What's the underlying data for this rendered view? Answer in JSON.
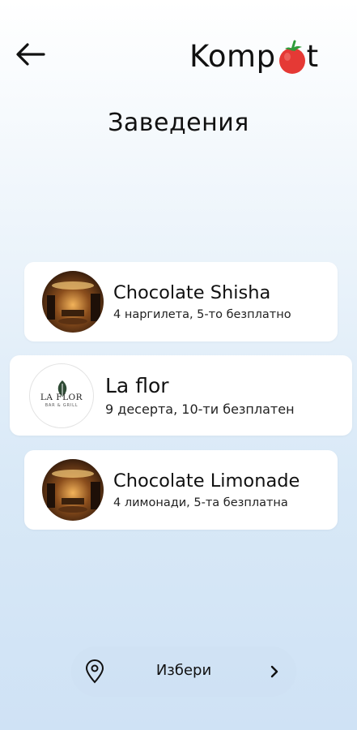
{
  "header": {
    "back_icon": "arrow-left-icon",
    "logo_left": "Komp",
    "logo_right": "t",
    "logo_icon": "tomato-icon",
    "logo_colors": {
      "tomato": "#e53935",
      "leaf": "#2e9c3a"
    }
  },
  "title": "Заведения",
  "venues": [
    {
      "name": "Chocolate Shisha",
      "offer": "4 наргилета, 5-то безплатно",
      "avatar": "restaurant-photo"
    },
    {
      "name": "La flor",
      "offer": "9 десерта, 10-ти безплатен",
      "avatar": "la-flor-logo",
      "logo_line1": "LA FLOR",
      "logo_line2": "BAR & GRILL"
    },
    {
      "name": "Chocolate Limonade",
      "offer": "4 лимонади, 5-та безплатна",
      "avatar": "restaurant-photo"
    }
  ],
  "location_selector": {
    "label": "Избери",
    "icon": "location-pin-icon",
    "chevron": "chevron-right-icon"
  }
}
